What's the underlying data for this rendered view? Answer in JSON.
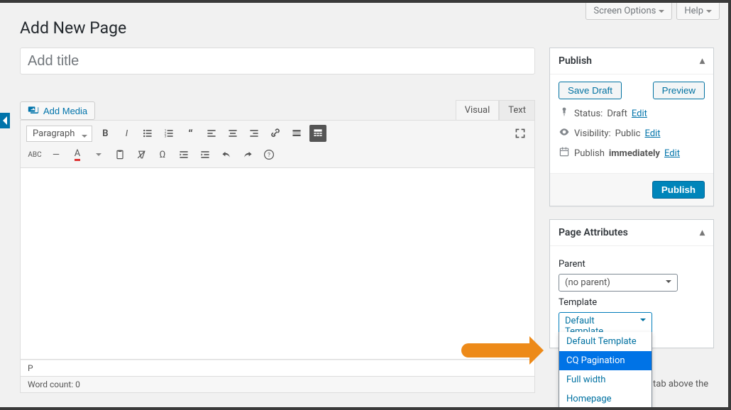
{
  "top": {
    "screen_options": "Screen Options",
    "help": "Help"
  },
  "page_title": "Add New Page",
  "title_input": {
    "placeholder": "Add title"
  },
  "add_media": "Add Media",
  "tabs": {
    "visual": "Visual",
    "text": "Text"
  },
  "toolbar": {
    "paragraph": "Paragraph"
  },
  "path_bar": "P",
  "word_count": "Word count: 0",
  "publish": {
    "title": "Publish",
    "save_draft": "Save Draft",
    "preview": "Preview",
    "status_label": "Status:",
    "status_value": "Draft",
    "visibility_label": "Visibility:",
    "visibility_value": "Public",
    "schedule_label": "Publish",
    "schedule_value": "immediately",
    "edit": "Edit",
    "publish_btn": "Publish"
  },
  "page_attributes": {
    "title": "Page Attributes",
    "parent_label": "Parent",
    "parent_value": "(no parent)",
    "template_label": "Template",
    "template_value": "Default Template",
    "template_options": [
      "Default Template",
      "CQ Pagination",
      "Full width",
      "Homepage"
    ]
  },
  "help_text_fragments": {
    "a": "tab above the"
  }
}
